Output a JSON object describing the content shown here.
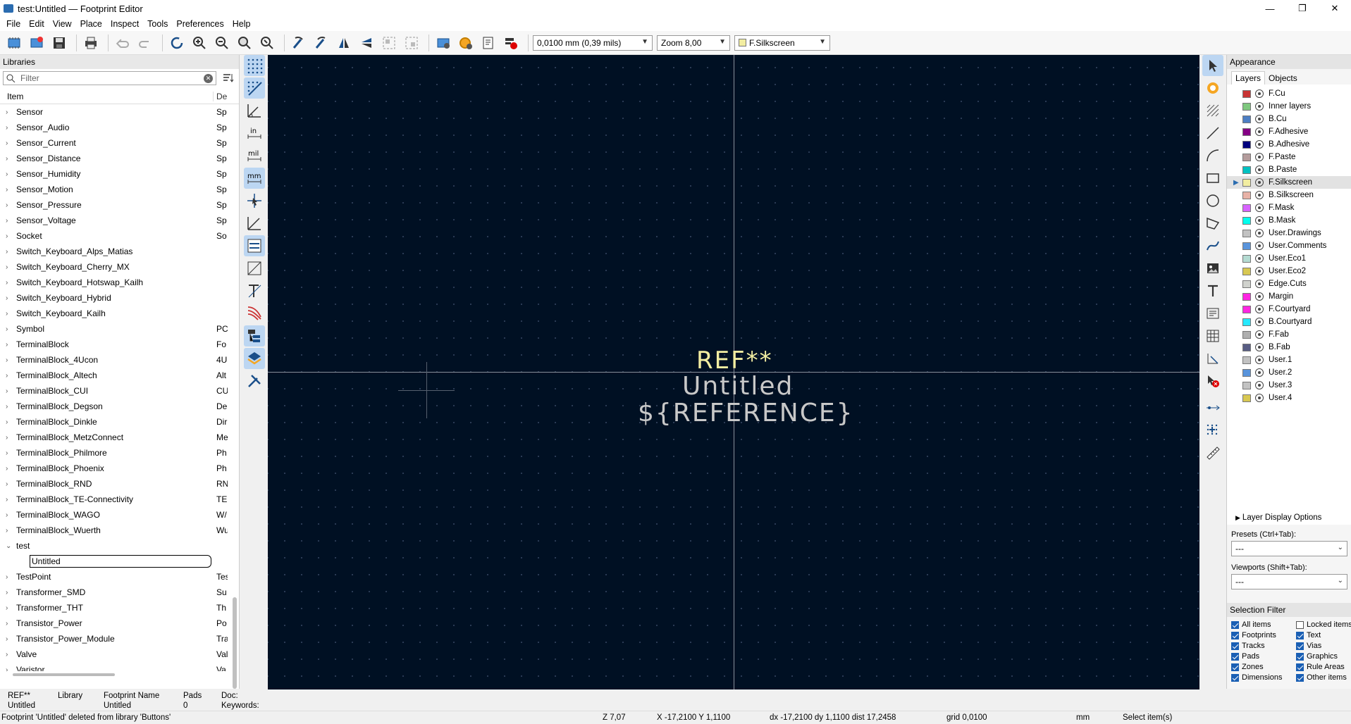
{
  "window": {
    "title": "test:Untitled — Footprint Editor",
    "minimize": "—",
    "maximize": "❐",
    "close": "✕"
  },
  "menu": [
    "File",
    "Edit",
    "View",
    "Place",
    "Inspect",
    "Tools",
    "Preferences",
    "Help"
  ],
  "toolbar": {
    "grid": "0,0100 mm (0,39 mils)",
    "zoom": "Zoom 8,00",
    "layer": "F.Silkscreen",
    "layer_color": "#f2eda1"
  },
  "libraries": {
    "header": "Libraries",
    "filter_placeholder": "Filter",
    "col_item": "Item",
    "col_desc": "De",
    "rows": [
      {
        "name": "Sensor",
        "desc": "Sp",
        "open": false
      },
      {
        "name": "Sensor_Audio",
        "desc": "Sp",
        "open": false
      },
      {
        "name": "Sensor_Current",
        "desc": "Sp",
        "open": false
      },
      {
        "name": "Sensor_Distance",
        "desc": "Sp",
        "open": false
      },
      {
        "name": "Sensor_Humidity",
        "desc": "Sp",
        "open": false
      },
      {
        "name": "Sensor_Motion",
        "desc": "Sp",
        "open": false
      },
      {
        "name": "Sensor_Pressure",
        "desc": "Sp",
        "open": false
      },
      {
        "name": "Sensor_Voltage",
        "desc": "Sp",
        "open": false
      },
      {
        "name": "Socket",
        "desc": "So",
        "open": false
      },
      {
        "name": "Switch_Keyboard_Alps_Matias",
        "desc": "",
        "open": false
      },
      {
        "name": "Switch_Keyboard_Cherry_MX",
        "desc": "",
        "open": false
      },
      {
        "name": "Switch_Keyboard_Hotswap_Kailh",
        "desc": "",
        "open": false
      },
      {
        "name": "Switch_Keyboard_Hybrid",
        "desc": "",
        "open": false
      },
      {
        "name": "Switch_Keyboard_Kailh",
        "desc": "",
        "open": false
      },
      {
        "name": "Symbol",
        "desc": "PC",
        "open": false
      },
      {
        "name": "TerminalBlock",
        "desc": "Fo",
        "open": false
      },
      {
        "name": "TerminalBlock_4Ucon",
        "desc": "4U",
        "open": false
      },
      {
        "name": "TerminalBlock_Altech",
        "desc": "Alt",
        "open": false
      },
      {
        "name": "TerminalBlock_CUI",
        "desc": "CU",
        "open": false
      },
      {
        "name": "TerminalBlock_Degson",
        "desc": "De",
        "open": false
      },
      {
        "name": "TerminalBlock_Dinkle",
        "desc": "Dir",
        "open": false
      },
      {
        "name": "TerminalBlock_MetzConnect",
        "desc": "Me",
        "open": false
      },
      {
        "name": "TerminalBlock_Philmore",
        "desc": "Ph",
        "open": false
      },
      {
        "name": "TerminalBlock_Phoenix",
        "desc": "Ph",
        "open": false
      },
      {
        "name": "TerminalBlock_RND",
        "desc": "RN",
        "open": false
      },
      {
        "name": "TerminalBlock_TE-Connectivity",
        "desc": "TE",
        "open": false
      },
      {
        "name": "TerminalBlock_WAGO",
        "desc": "W/",
        "open": false
      },
      {
        "name": "TerminalBlock_Wuerth",
        "desc": "Wu",
        "open": false
      },
      {
        "name": "test",
        "desc": "",
        "open": true
      },
      {
        "name": "Untitled",
        "desc": "",
        "child": true
      },
      {
        "name": "TestPoint",
        "desc": "Tes",
        "open": false
      },
      {
        "name": "Transformer_SMD",
        "desc": "Su",
        "open": false
      },
      {
        "name": "Transformer_THT",
        "desc": "Th",
        "open": false
      },
      {
        "name": "Transistor_Power",
        "desc": "Po",
        "open": false
      },
      {
        "name": "Transistor_Power_Module",
        "desc": "Tra",
        "open": false
      },
      {
        "name": "Valve",
        "desc": "Val",
        "open": false
      },
      {
        "name": "Varistor",
        "desc": "Va",
        "open": false
      }
    ]
  },
  "canvas": {
    "ref_value": "REF**",
    "value_text": "Untitled",
    "ref_text": "${REFERENCE}"
  },
  "appearance": {
    "header": "Appearance",
    "tab_layers": "Layers",
    "tab_objects": "Objects",
    "layers": [
      {
        "name": "F.Cu",
        "color": "#c83434"
      },
      {
        "name": "Inner layers",
        "color": "#7fc87f"
      },
      {
        "name": "B.Cu",
        "color": "#4d7fc4"
      },
      {
        "name": "F.Adhesive",
        "color": "#840084"
      },
      {
        "name": "B.Adhesive",
        "color": "#00007d"
      },
      {
        "name": "F.Paste",
        "color": "#b49c9c"
      },
      {
        "name": "B.Paste",
        "color": "#00c2c2"
      },
      {
        "name": "F.Silkscreen",
        "color": "#f2eda1",
        "selected": true
      },
      {
        "name": "B.Silkscreen",
        "color": "#e8b2a7"
      },
      {
        "name": "F.Mask",
        "color": "#d864ff"
      },
      {
        "name": "B.Mask",
        "color": "#02ffee"
      },
      {
        "name": "User.Drawings",
        "color": "#c2c2c2"
      },
      {
        "name": "User.Comments",
        "color": "#5994dc"
      },
      {
        "name": "User.Eco1",
        "color": "#b4dbd2"
      },
      {
        "name": "User.Eco2",
        "color": "#d8c852"
      },
      {
        "name": "Edge.Cuts",
        "color": "#d0d2cd"
      },
      {
        "name": "Margin",
        "color": "#ff26e2"
      },
      {
        "name": "F.Courtyard",
        "color": "#ff26e2"
      },
      {
        "name": "B.Courtyard",
        "color": "#26e9ff"
      },
      {
        "name": "F.Fab",
        "color": "#afafaf"
      },
      {
        "name": "B.Fab",
        "color": "#585d84"
      },
      {
        "name": "User.1",
        "color": "#c2c2c2"
      },
      {
        "name": "User.2",
        "color": "#5994dc"
      },
      {
        "name": "User.3",
        "color": "#c2c2c2"
      },
      {
        "name": "User.4",
        "color": "#d8c852"
      }
    ],
    "layer_display_options": "Layer Display Options",
    "presets_label": "Presets (Ctrl+Tab):",
    "presets_value": "---",
    "viewports_label": "Viewports (Shift+Tab):",
    "viewports_value": "---"
  },
  "selection_filter": {
    "header": "Selection Filter",
    "items": [
      {
        "label": "All items",
        "checked": true
      },
      {
        "label": "Locked items",
        "checked": false
      },
      {
        "label": "Footprints",
        "checked": true
      },
      {
        "label": "Text",
        "checked": true
      },
      {
        "label": "Tracks",
        "checked": true
      },
      {
        "label": "Vias",
        "checked": true
      },
      {
        "label": "Pads",
        "checked": true
      },
      {
        "label": "Graphics",
        "checked": true
      },
      {
        "label": "Zones",
        "checked": true
      },
      {
        "label": "Rule Areas",
        "checked": true
      },
      {
        "label": "Dimensions",
        "checked": true
      },
      {
        "label": "Other items",
        "checked": true
      }
    ]
  },
  "infobar": {
    "ref_label": "REF**",
    "ref_val": "Untitled",
    "lib_label": "Library",
    "lib_val": "",
    "fp_label": "Footprint Name",
    "fp_val": "Untitled",
    "pads_label": "Pads",
    "pads_val": "0",
    "doc_label": "Doc:",
    "kw_label": "Keywords:"
  },
  "statusbar": {
    "msg": "Footprint 'Untitled' deleted from library 'Buttons'",
    "z": "Z 7,07",
    "xy": "X -17,2100  Y 1,1100",
    "d": "dx -17,2100  dy 1,1100  dist 17,2458",
    "grid": "grid 0,0100",
    "units": "mm",
    "action": "Select item(s)"
  }
}
